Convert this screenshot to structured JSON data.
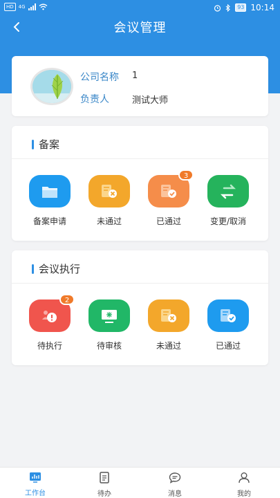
{
  "status_bar": {
    "carrier_chip": "HD",
    "network": "4G",
    "battery": "93",
    "time": "10:14"
  },
  "nav": {
    "title": "会议管理"
  },
  "company": {
    "name_label": "公司名称",
    "name_value": "1",
    "owner_label": "负责人",
    "owner_value": "测试大师"
  },
  "filing": {
    "title": "备案",
    "items": [
      {
        "label": "备案申请",
        "icon": "folder-icon",
        "color": "#1e9bef"
      },
      {
        "label": "未通过",
        "icon": "rejected-doc-icon",
        "color": "#f3a72b"
      },
      {
        "label": "已通过",
        "icon": "approved-doc-icon",
        "color": "#f58d4a",
        "badge": "3"
      },
      {
        "label": "变更/取消",
        "icon": "swap-arrows-icon",
        "color": "#25b35c"
      }
    ]
  },
  "execution": {
    "title": "会议执行",
    "items": [
      {
        "label": "待执行",
        "icon": "pending-people-icon",
        "color": "#f0554d",
        "badge": "2"
      },
      {
        "label": "待审核",
        "icon": "review-monitor-icon",
        "color": "#21b767"
      },
      {
        "label": "未通过",
        "icon": "rejected-doc-icon",
        "color": "#f3a72b"
      },
      {
        "label": "已通过",
        "icon": "approved-doc-icon",
        "color": "#1e9bef"
      }
    ]
  },
  "tabbar": {
    "items": [
      {
        "label": "工作台",
        "icon": "workbench-icon",
        "active": true
      },
      {
        "label": "待办",
        "icon": "todo-icon",
        "active": false
      },
      {
        "label": "消息",
        "icon": "message-icon",
        "active": false
      },
      {
        "label": "我的",
        "icon": "profile-icon",
        "active": false
      }
    ]
  },
  "colors": {
    "primary": "#2d8fe3",
    "badge": "#f07a2a",
    "background": "#f2f3f5"
  }
}
